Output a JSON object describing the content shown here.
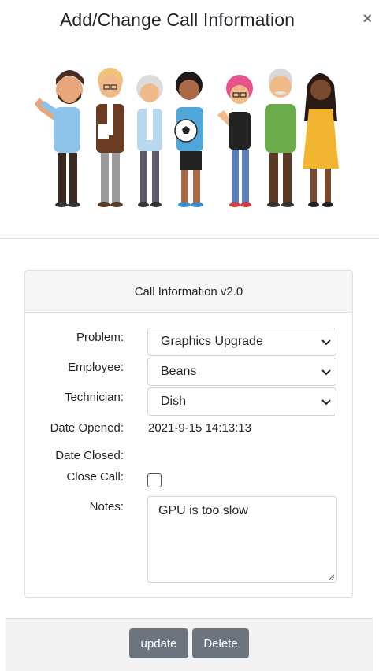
{
  "modal": {
    "title": "Add/Change Call Information",
    "close_symbol": "×"
  },
  "card": {
    "header": "Call Information v2.0",
    "fields": {
      "problem_label": "Problem:",
      "problem_value": "Graphics Upgrade",
      "employee_label": "Employee:",
      "employee_value": "Beans",
      "technician_label": "Technician:",
      "technician_value": "Dish",
      "date_opened_label": "Date Opened:",
      "date_opened_value": "2021-9-15 14:13:13",
      "date_closed_label": "Date Closed:",
      "date_closed_value": "",
      "close_call_label": "Close Call:",
      "close_call_checked": false,
      "notes_label": "Notes:",
      "notes_value": "GPU is too slow"
    }
  },
  "footer": {
    "update_label": "update",
    "delete_label": "Delete"
  },
  "colors": {
    "button_bg": "#6c757d",
    "card_header_bg": "#f7f7f7",
    "footer_bg": "#f3f3f3"
  },
  "icons": [
    "close-icon",
    "chevron-down-icon",
    "people-illustration"
  ]
}
